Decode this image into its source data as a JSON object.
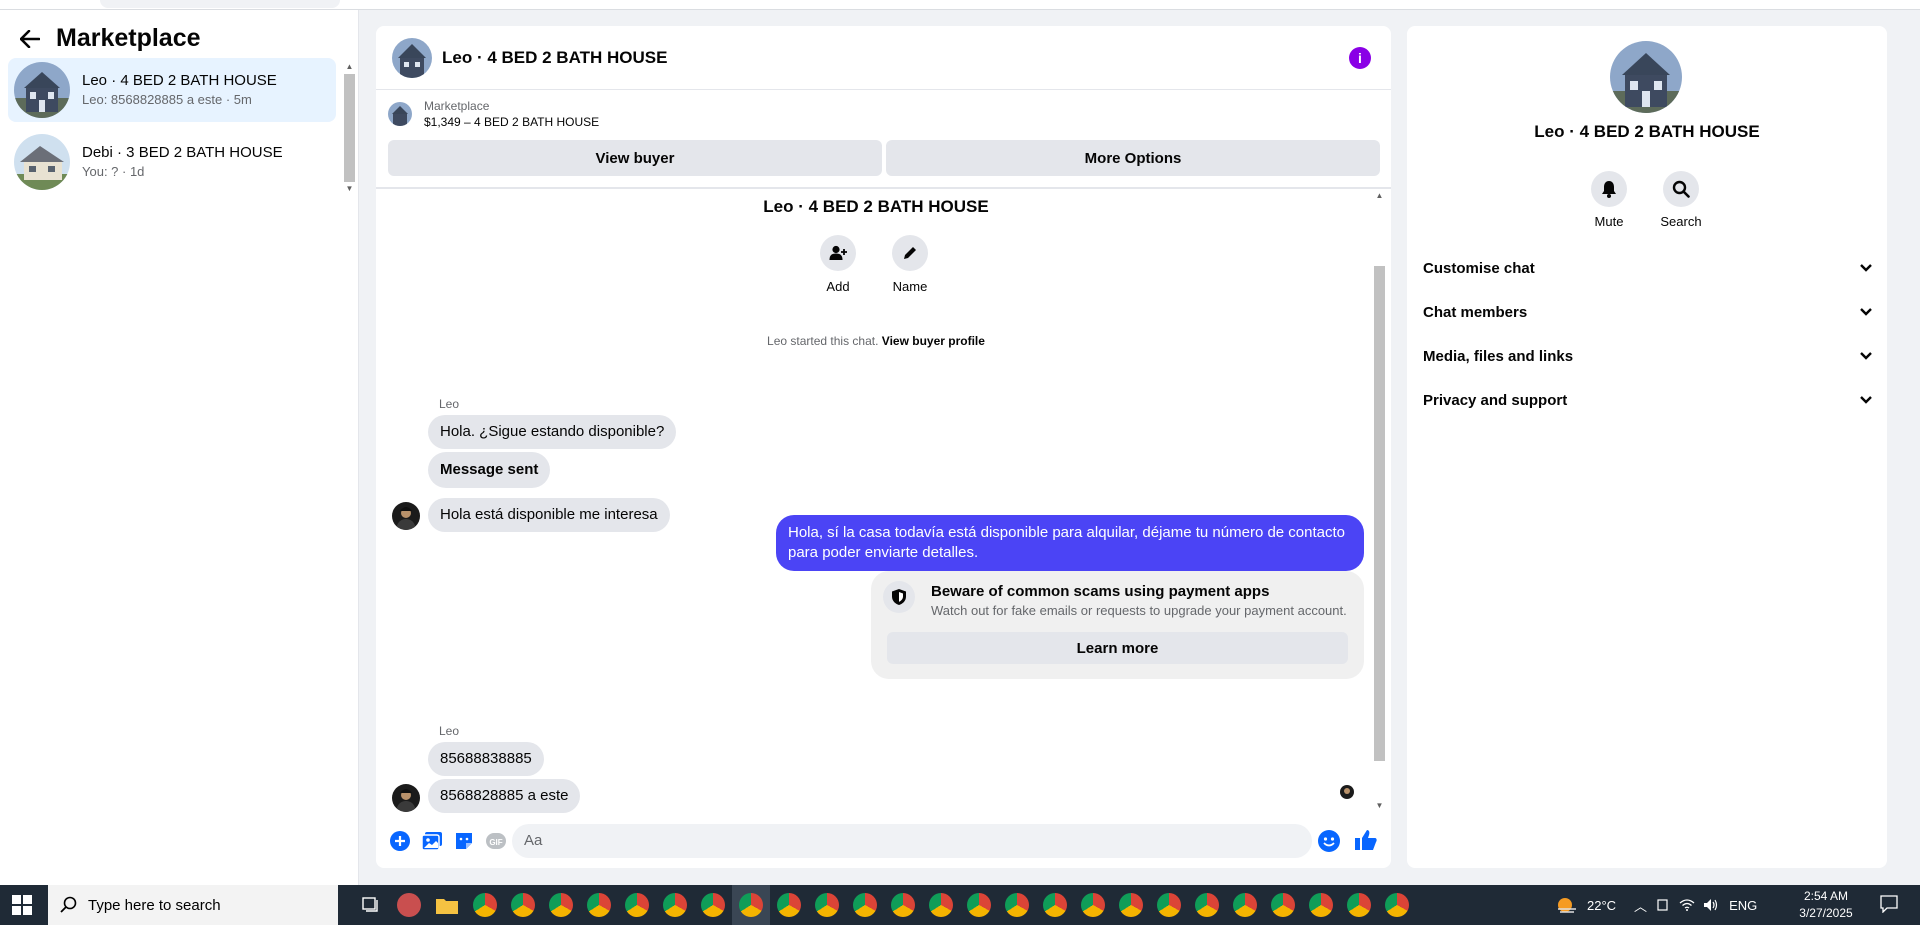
{
  "sidebar": {
    "title": "Marketplace",
    "conversations": [
      {
        "name": "Leo · 4 BED 2 BATH HOUSE",
        "preview": "Leo: 8568828885 a este · 5m"
      },
      {
        "name": "Debi · 3 BED 2 BATH HOUSE",
        "preview": "You: ? · 1d"
      }
    ]
  },
  "chat": {
    "header_title": "Leo · 4 BED 2 BATH HOUSE",
    "listing": {
      "source": "Marketplace",
      "price_title": "$1,349 – 4 BED 2 BATH HOUSE"
    },
    "buttons": {
      "view_buyer": "View buyer",
      "more_options": "More Options"
    },
    "intro": {
      "title": "Leo · 4 BED 2 BATH HOUSE",
      "add_label": "Add",
      "name_label": "Name",
      "started_text": "Leo started this chat.",
      "view_profile": "View buyer profile"
    },
    "messages": {
      "sender1": "Leo",
      "m1": "Hola. ¿Sigue estando disponible?",
      "m2": "Message sent",
      "m3": "Hola está disponible me interesa",
      "out1": "Hola, sí la casa todavía está disponible para alquilar, déjame tu número de contacto para poder enviarte detalles.",
      "sender2": "Leo",
      "m4": "85688838885",
      "m5": "8568828885 a este"
    },
    "scam_notice": {
      "title": "Beware of common scams using payment apps",
      "desc": "Watch out for fake emails or requests to upgrade your payment account.",
      "button": "Learn more"
    },
    "composer_placeholder": "Aa"
  },
  "details": {
    "title": "Leo · 4 BED 2 BATH HOUSE",
    "mute": "Mute",
    "search": "Search",
    "sections": [
      "Customise chat",
      "Chat members",
      "Media, files and links",
      "Privacy and support"
    ]
  },
  "taskbar": {
    "search_placeholder": "Type here to search",
    "temperature": "22°C",
    "language": "ENG",
    "time": "2:54 AM",
    "date": "3/27/2025"
  },
  "colors": {
    "accent": "#0866ff",
    "outgoing_bubble": "#4b44f5",
    "info_icon": "#8a00e6"
  }
}
